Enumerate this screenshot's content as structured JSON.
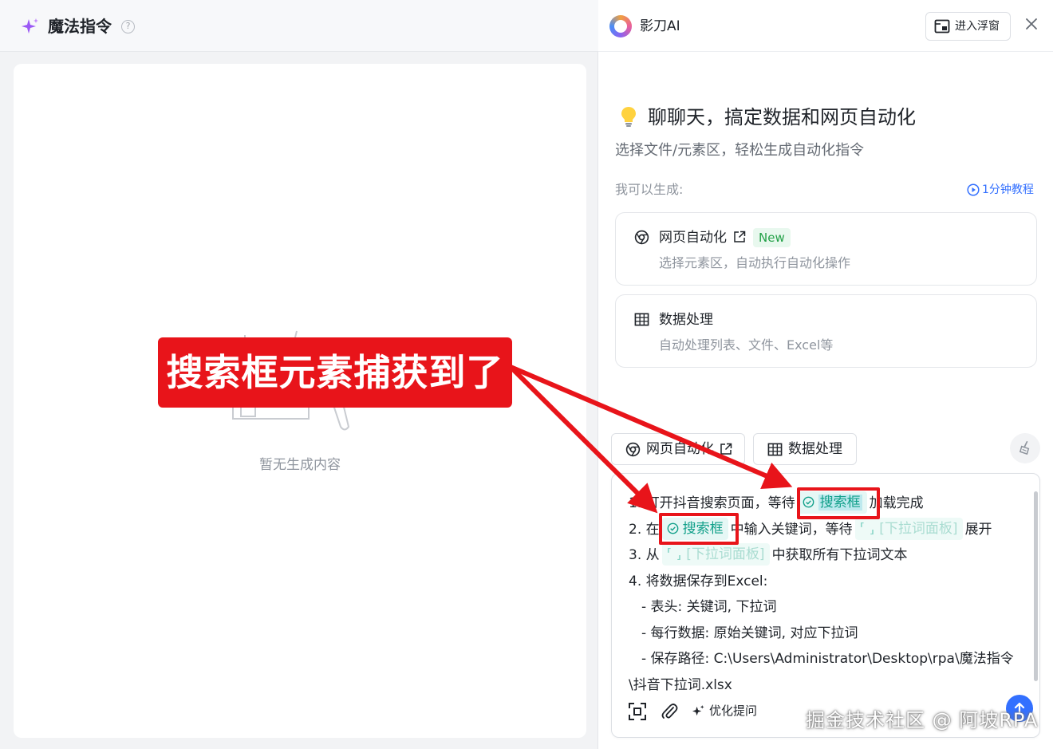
{
  "left_panel": {
    "title": "魔法指令",
    "help_glyph": "?",
    "empty_text": "暂无生成内容"
  },
  "right_panel": {
    "app_name": "影刀AI",
    "float_button": "进入浮窗",
    "welcome_title": "聊聊天，搞定数据和网页自动化",
    "welcome_subtitle": "选择文件/元素区，轻松生成自动化指令",
    "can_generate": "我可以生成:",
    "tutorial_link": "1分钟教程",
    "cards": [
      {
        "title": "网页自动化",
        "badge": "New",
        "desc": "选择元素区，自动执行自动化操作",
        "icon": "chrome-icon"
      },
      {
        "title": "数据处理",
        "desc": "自动处理列表、文件、Excel等",
        "icon": "table-icon"
      }
    ],
    "quick_buttons": [
      {
        "label": "网页自动化",
        "icon": "chrome-icon"
      },
      {
        "label": "数据处理",
        "icon": "table-icon"
      }
    ],
    "instructions": {
      "line1": {
        "prefix": "1. 打开抖音搜索页面，等待",
        "tag": "搜索框",
        "suffix": "加载完成"
      },
      "line2": {
        "prefix": "2. 在",
        "tag": "搜索框",
        "middle": "中输入关键词，等待",
        "pending_tag": "[下拉词面板]",
        "suffix": "展开"
      },
      "line3": {
        "prefix": "3. 从",
        "pending_tag": "[下拉词面板]",
        "suffix": "中获取所有下拉词文本"
      },
      "line4": "4. 将数据保存到Excel:",
      "line5": "- 表头: 关键词, 下拉词",
      "line6": "- 每行数据: 原始关键词, 对应下拉词",
      "line7": "- 保存路径: C:\\Users\\Administrator\\Desktop\\rpa\\魔法指令",
      "line8": "\\抖音下拉词.xlsx"
    },
    "toolbar": {
      "optimize_label": "优化提问"
    }
  },
  "annotation": {
    "banner_text": "搜索框元素捕获到了",
    "color": "#e8141a"
  },
  "watermark": "掘金技术社区 @ 阿坡RPA",
  "colors": {
    "accent_blue": "#3370ff",
    "tag_green": "#12a08a",
    "new_badge_green": "#24a148",
    "magic_purple": "#9b59f5"
  }
}
